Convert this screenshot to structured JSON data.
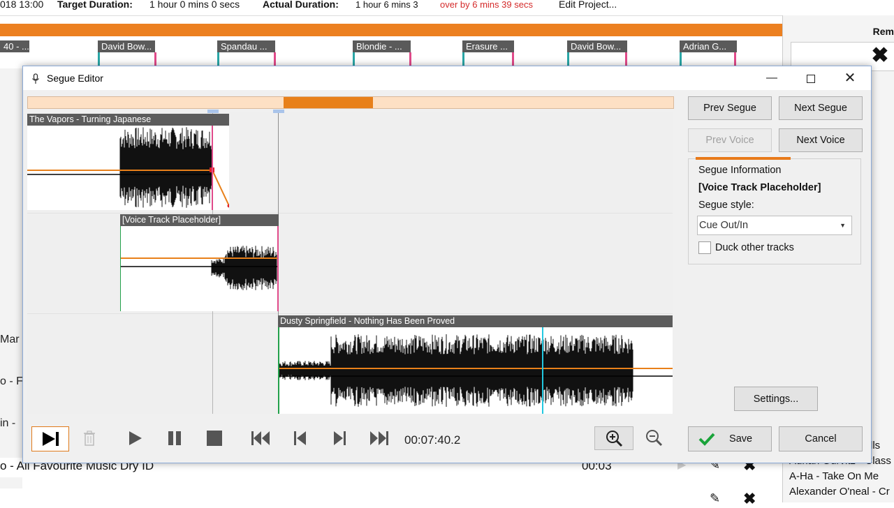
{
  "background": {
    "topbar": {
      "date_fragment": "018 13:00",
      "target_label": "Target Duration:",
      "target_value": "1 hour 0 mins 0 secs",
      "actual_label": "Actual Duration:",
      "actual_value": "1 hour 6 mins 3",
      "over_text": "over by 6 mins 39 secs",
      "edit_project": "Edit Project..."
    },
    "track_clips": [
      "40 - ...",
      "David Bow...",
      "Spandau ...",
      "Blondie - ...",
      "Erasure ...",
      "David Bow...",
      "Adrian G..."
    ],
    "right_panel_header": "Rem",
    "left_fragments": [
      "Mar",
      "o - F",
      "in -",
      "o -"
    ],
    "bottom_row": {
      "title": "o - All Favourite Music Dry ID",
      "duration": "00:03"
    },
    "right_list": [
      "lls",
      "Adrian Gurvitz - Class",
      "A-Ha - Take On Me",
      "Alexander O'neal - Cr"
    ]
  },
  "dialog": {
    "title": "Segue Editor",
    "tracks": [
      {
        "name": "The Vapors - Turning Japanese"
      },
      {
        "name": "[Voice Track Placeholder]"
      },
      {
        "name": "Dusty Springfield - Nothing Has Been Proved"
      }
    ],
    "buttons": {
      "prev_segue": "Prev Segue",
      "next_segue": "Next Segue",
      "prev_voice": "Prev Voice",
      "next_voice": "Next Voice",
      "settings": "Settings...",
      "save": "Save",
      "cancel": "Cancel"
    },
    "segue_info": {
      "heading": "Segue Information",
      "track": "[Voice Track Placeholder]",
      "style_label": "Segue style:",
      "style_value": "Cue Out/In",
      "duck_label": "Duck other tracks",
      "duck_checked": false
    },
    "transport": {
      "time": "00:07:40.2"
    }
  },
  "colors": {
    "accent_orange": "#e8801a",
    "waveform": "#111111",
    "playhead": "#22c8e0",
    "save_check": "#1aa33a"
  }
}
